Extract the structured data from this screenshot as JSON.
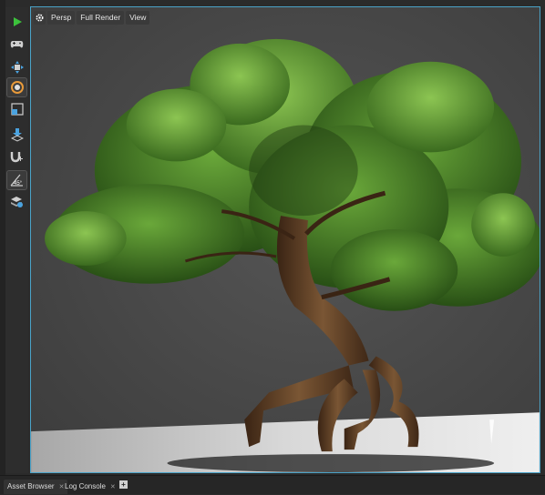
{
  "viewport": {
    "camera_mode": "Persp",
    "render_mode": "Full Render",
    "view_menu": "View",
    "settings_icon": "gear-icon"
  },
  "toolbar": {
    "tools": [
      {
        "name": "play-icon",
        "color": "#3cc23c"
      },
      {
        "name": "gamepad-icon"
      },
      {
        "name": "move-icon"
      },
      {
        "name": "rotate-icon",
        "active": true,
        "color": "#e89a3a"
      },
      {
        "name": "scale-icon"
      },
      {
        "name": "snap-to-ground-icon",
        "color": "#4aa3e0"
      },
      {
        "name": "magnet-icon"
      },
      {
        "name": "angle-snap-icon",
        "label": "45°"
      },
      {
        "name": "layers-icon",
        "color": "#4aa3e0"
      }
    ]
  },
  "bottom_tabs": [
    {
      "label": "Asset Browser",
      "active": true
    },
    {
      "label": "Log Console",
      "active": false
    }
  ],
  "colors": {
    "accent": "#4aa3c8",
    "viewport_bg": "#464646",
    "foliage": "#3f7a22"
  }
}
